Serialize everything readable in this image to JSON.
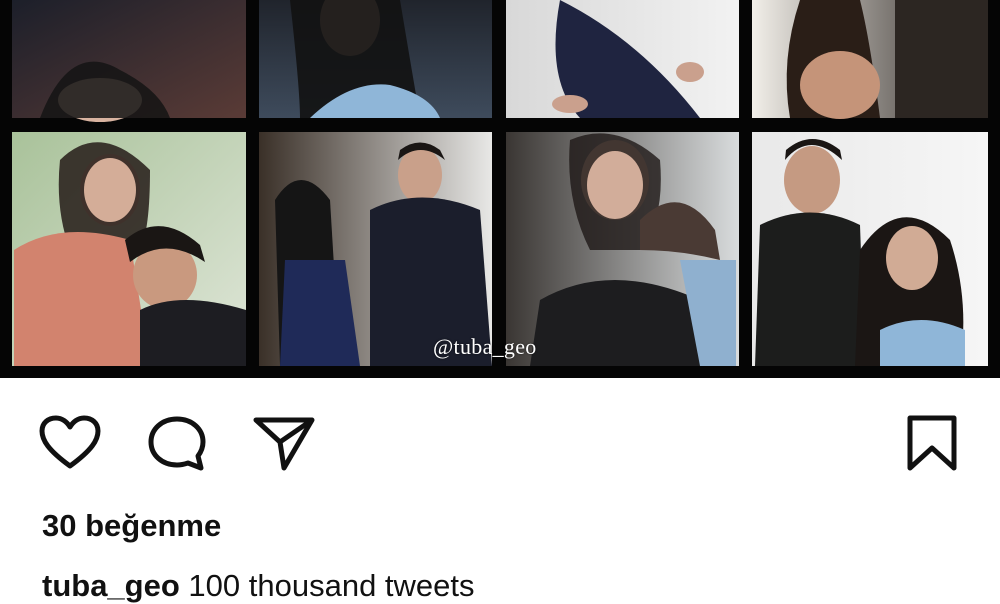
{
  "post": {
    "image": {
      "description": "collage",
      "watermark": "@tuba_geo"
    },
    "actions": {
      "like_icon": "heart-icon",
      "comment_icon": "comment-icon",
      "share_icon": "paper-plane-icon",
      "save_icon": "bookmark-icon"
    },
    "likes_text": "30 beğenme",
    "caption": {
      "username": "tuba_geo",
      "text": "100 thousand tweets"
    }
  },
  "colors": {
    "background": "#ffffff",
    "collage_bg": "#050505",
    "text": "#111111"
  }
}
